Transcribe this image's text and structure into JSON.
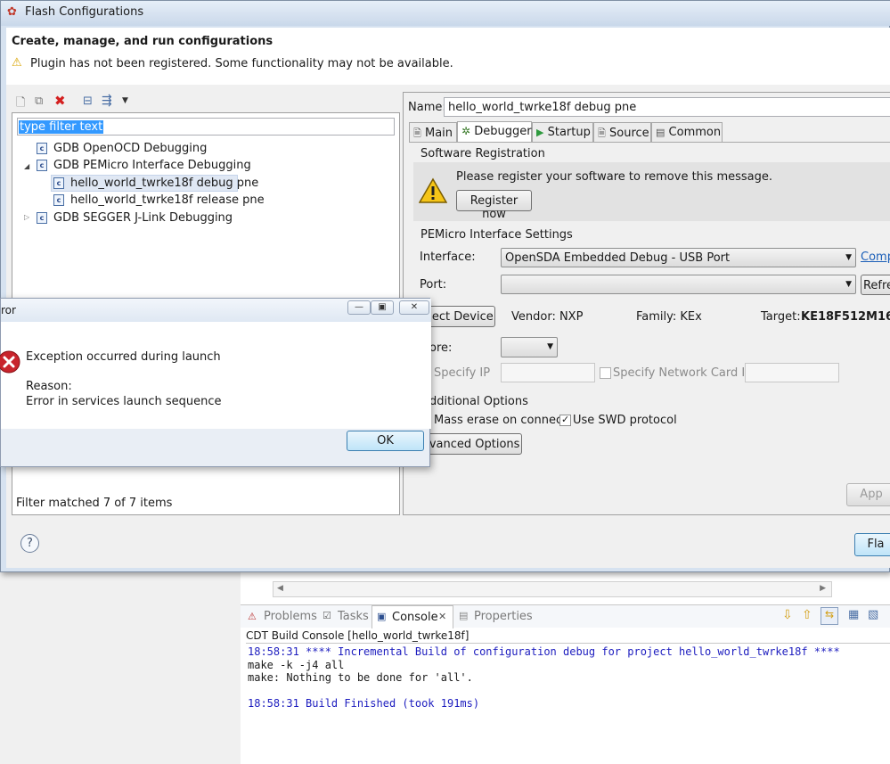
{
  "window": {
    "title": "Flash Configurations",
    "header_title": "Create, manage, and run configurations",
    "warning_text": "Plugin has not been registered. Some functionality may not be available."
  },
  "left_panel": {
    "filter_text": "type filter text",
    "tree": [
      {
        "label": "GDB OpenOCD Debugging"
      },
      {
        "label": "GDB PEMicro Interface Debugging"
      },
      {
        "label": "hello_world_twrke18f debug pne"
      },
      {
        "label": "hello_world_twrke18f release pne"
      },
      {
        "label": "GDB SEGGER J-Link Debugging"
      }
    ],
    "status": "Filter matched 7 of 7 items"
  },
  "config": {
    "name_label": "Name:",
    "name_value": "hello_world_twrke18f debug pne",
    "tabs": [
      "Main",
      "Debugger",
      "Startup",
      "Source",
      "Common"
    ],
    "software_registration": {
      "title": "Software Registration",
      "message": "Please register your software to remove this message.",
      "button": "Register now"
    },
    "pemicro": {
      "title": "PEMicro Interface Settings",
      "interface_label": "Interface:",
      "interface_value": "OpenSDA Embedded Debug - USB Port",
      "compare_link": "Comp",
      "port_label": "Port:",
      "refresh_button": "Refre",
      "select_device_button": "elect Device",
      "vendor": "Vendor: NXP",
      "family": "Family: KEx",
      "target_label": "Target:",
      "target_value": "KE18F512M16",
      "core_label": "ore:",
      "specify_ip": "Specify IP",
      "specify_network_card_ip": "Specify Network Card IP"
    },
    "additional": {
      "title": "dditional Options",
      "mass_erase": "Mass erase on connect",
      "use_swd": "Use SWD protocol",
      "advanced_button": "dvanced Options"
    },
    "apply_button": "App",
    "flash_button": "Fla"
  },
  "error_dialog": {
    "title": "ror",
    "heading": "Exception occurred during launch",
    "reason_label": "Reason:",
    "reason_text": "Error in services launch sequence",
    "ok_button": "OK"
  },
  "console": {
    "tabs": [
      "Problems",
      "Tasks",
      "Console",
      "Properties"
    ],
    "header": "CDT Build Console [hello_world_twrke18f]",
    "lines": [
      "18:58:31 **** Incremental Build of configuration debug for project hello_world_twrke18f ****",
      "make -k -j4 all",
      "make: Nothing to be done for 'all'.",
      "",
      "18:58:31 Build Finished (took 191ms)"
    ]
  },
  "colors": {
    "title_bar": "#c9d8ea",
    "link": "#1b5fb8",
    "error_red": "#c8242c",
    "console_blue": "#1d1dbf"
  }
}
